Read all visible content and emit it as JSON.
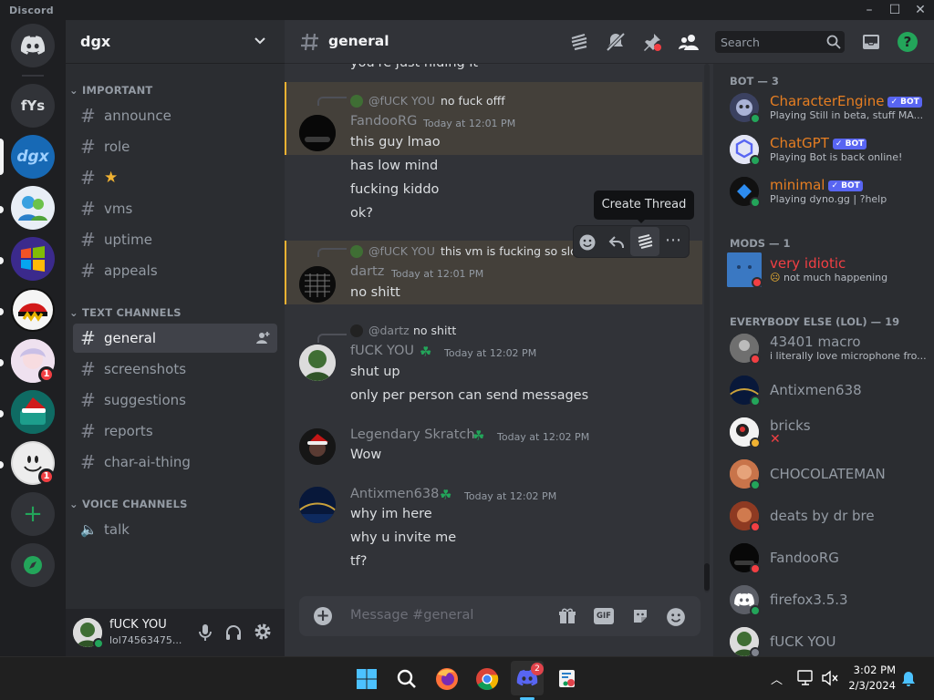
{
  "window": {
    "app_title": "Discord"
  },
  "servers": [
    {
      "abbr": "fYs"
    },
    {
      "abbr": "dgx"
    },
    {
      "badge": "1"
    },
    {
      "badge": "1"
    }
  ],
  "guild": {
    "name": "dgx"
  },
  "categories": {
    "important": "IMPORTANT",
    "text": "TEXT CHANNELS",
    "voice": "VOICE CHANNELS"
  },
  "important_channels": [
    "announce",
    "role",
    "",
    "vms",
    "uptime",
    "appeals"
  ],
  "text_channels": [
    "general",
    "screenshots",
    "suggestions",
    "reports",
    "char-ai-thing"
  ],
  "voice_channels": [
    "talk"
  ],
  "user": {
    "name": "fUCK YOU",
    "tag": "lol74563475..."
  },
  "chat": {
    "channel": "general",
    "search_placeholder": "Search",
    "input_placeholder": "Message #general",
    "gif_label": "GIF",
    "tooltip": "Create Thread",
    "partial_top": "you're just hiding it",
    "messages": [
      {
        "reply_name": "@fUCK YOU",
        "reply_text": "no fuck offf",
        "author": "FandooRG",
        "time": "Today at 12:01 PM",
        "lines": [
          "this guy lmao",
          "has low mind",
          "fucking kiddo",
          "ok?"
        ]
      },
      {
        "reply_name": "@fUCK YOU",
        "reply_text": "this vm is fucking so slow",
        "author": "dartz",
        "time": "Today at 12:01 PM",
        "lines": [
          "no shitt"
        ]
      },
      {
        "reply_name": "@dartz",
        "reply_text": "no shitt",
        "author": "fUCK YOU",
        "time": "Today at 12:02 PM",
        "lines": [
          "shut up",
          "only per person can send messages"
        ]
      },
      {
        "author": "Legendary Skratch",
        "time": "Today at 12:02 PM",
        "lines": [
          "Wow"
        ]
      },
      {
        "author": "Antixmen638",
        "time": "Today at 12:02 PM",
        "lines": [
          "why im here",
          "why u invite me",
          "tf?"
        ]
      }
    ]
  },
  "members": {
    "groups": [
      "BOT — 3",
      "MODS — 1",
      "EVERYBODY ELSE (LOL) — 19"
    ],
    "bot_label": "BOT",
    "bots": [
      {
        "name": "CharacterEngine",
        "status": "Playing Still in beta, stuff MA..."
      },
      {
        "name": "ChatGPT",
        "status": "Playing Bot is back online!"
      },
      {
        "name": "minimal",
        "status": "Playing dyno.gg | ?help"
      }
    ],
    "mods": [
      {
        "name": "very idiotic",
        "status": "not much happening"
      }
    ],
    "everyone": [
      {
        "name": "43401 macro",
        "status": "i literally love microphone fro..."
      },
      {
        "name": "Antixmen638"
      },
      {
        "name": "bricks",
        "status": "✕"
      },
      {
        "name": "CHOCOLATEMAN"
      },
      {
        "name": "deats by dr bre"
      },
      {
        "name": "FandooRG"
      },
      {
        "name": "firefox3.5.3"
      },
      {
        "name": "fUCK YOU"
      }
    ]
  },
  "taskbar": {
    "time": "3:02 PM",
    "date": "2/3/2024",
    "discord_badge": "2"
  },
  "colors": {
    "accent": "#5865f2",
    "online": "#23a55a",
    "dnd": "#f23f43",
    "idle": "#f0b232",
    "mod_name": "#f23f43",
    "bot_name": "#e67e22",
    "reply_highlight": "#44403a"
  }
}
